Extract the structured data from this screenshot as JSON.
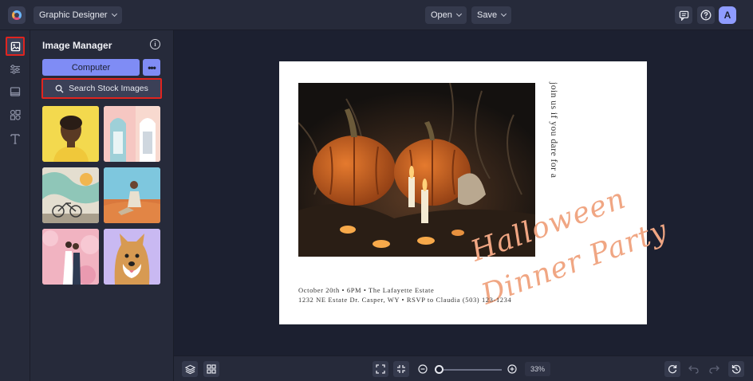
{
  "topbar": {
    "app_mode": "Graphic Designer",
    "open_label": "Open",
    "save_label": "Save",
    "avatar_initial": "A"
  },
  "rail": {
    "items": [
      "image-icon",
      "sliders-icon",
      "layout-icon",
      "elements-icon",
      "text-icon"
    ],
    "active": "image-icon"
  },
  "panel": {
    "title": "Image Manager",
    "computer_label": "Computer",
    "more_label": "•••",
    "stock_label": "Search Stock Images",
    "thumbnails": [
      "portrait-woman",
      "colorful-doors",
      "bicycle-mural",
      "man-on-sand",
      "wedding-couple",
      "shiba-dog"
    ]
  },
  "design": {
    "side_text": "join us if you dare for a",
    "script_line1": "Halloween",
    "script_line2": "Dinner Party",
    "info_line1": "October 20th • 6PM • The Lafayette Estate",
    "info_line2": "1232 NE Estate Dr. Casper, WY • RSVP to Claudia (503) 123-1234",
    "accent_color": "#f0a683"
  },
  "bottombar": {
    "zoom": "33%"
  },
  "colors": {
    "accent": "#7f8cf5",
    "highlight": "#e0241f",
    "background": "#1c2030"
  }
}
